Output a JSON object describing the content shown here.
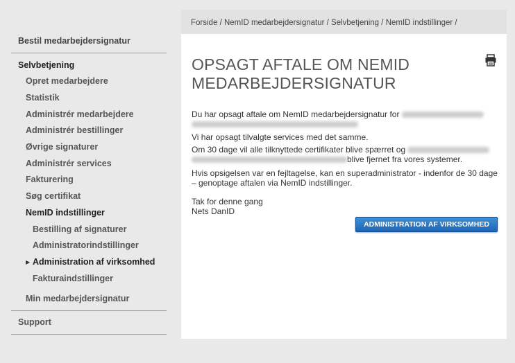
{
  "sidebar": {
    "order": "Bestil medarbejdersignatur",
    "selfservice": "Selvbetjening",
    "items": [
      "Opret medarbejdere",
      "Statistik",
      "Administrér medarbejdere",
      "Administrér bestillinger",
      "Øvrige signaturer",
      "Administrér services",
      "Fakturering",
      "Søg certifikat",
      "NemID indstillinger"
    ],
    "subitems": [
      "Bestilling af signaturer",
      "Administratorindstillinger",
      "Administration af virksomhed",
      "Fakturaindstillinger"
    ],
    "my_signature": "Min medarbejdersignatur",
    "support": "Support"
  },
  "breadcrumb": {
    "items": [
      "Forside",
      "NemID medarbejdersignatur",
      "Selvbetjening",
      "NemID indstillinger"
    ],
    "sep": "/"
  },
  "main": {
    "title": "OPSAGT AFTALE OM NEMID MEDARBEJDERSIGNATUR",
    "p1": "Du har opsagt aftale om NemID medarbejdersignatur for",
    "p2": "Vi har opsagt tilvalgte services med det samme.",
    "p3a": "Om 30 dage vil alle tilknyttede certifikater blive spærret og",
    "p3b": "blive fjernet fra vores systemer.",
    "p4": "Hvis opsigelsen var en fejltagelse, kan en superadministrator - indenfor de 30 dage – genoptage aftalen via NemID indstillinger.",
    "sign1": "Tak for denne gang",
    "sign2": "Nets DanID",
    "button": "ADMINISTRATION AF VIRKSOMHED"
  },
  "icons": {
    "print": "print-icon"
  },
  "colors": {
    "button": "#2a78c5",
    "background": "#e9e9ea",
    "panel": "#ffffff"
  }
}
